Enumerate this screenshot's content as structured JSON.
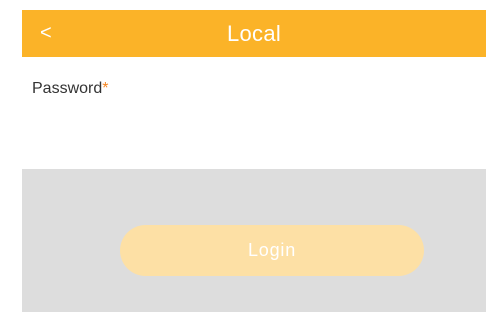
{
  "header": {
    "back_label": "<",
    "title": "Local"
  },
  "form": {
    "password_label": "Password",
    "required_marker": "*",
    "password_value": "",
    "password_placeholder": ""
  },
  "actions": {
    "login_label": "Login"
  },
  "colors": {
    "header_bg": "#fbb328",
    "required": "#f5841f",
    "footer_bg": "#dddddd",
    "login_bg_disabled": "#fde0a5"
  },
  "state": {
    "login_enabled": false
  }
}
